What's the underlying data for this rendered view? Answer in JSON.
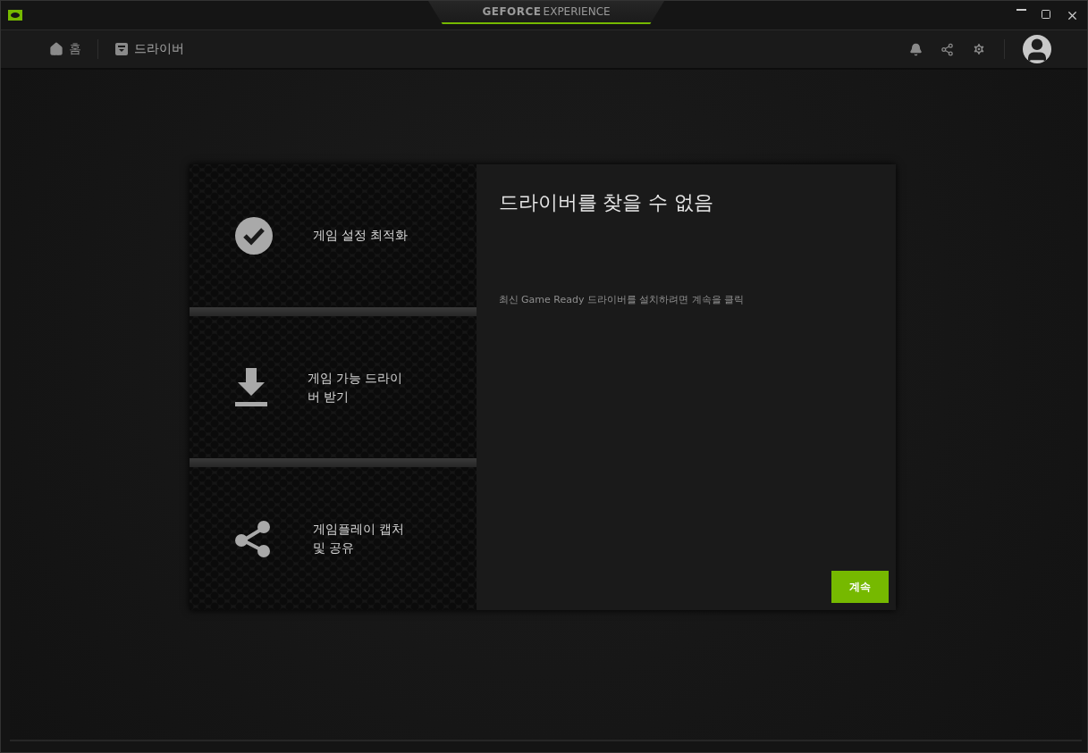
{
  "window": {
    "logo": {
      "brand": "GEFORCE",
      "product": "EXPERIENCE"
    }
  },
  "nav": {
    "tabs": [
      {
        "label": "홈",
        "kind": "home",
        "selected": false
      },
      {
        "label": "드라이버",
        "kind": "driver",
        "selected": true
      }
    ]
  },
  "features": [
    {
      "kind": "check",
      "label": "게임 설정 최적화"
    },
    {
      "kind": "download",
      "label": "게임 가능 드라이\n버 받기"
    },
    {
      "kind": "share",
      "label": "게임플레이 캡처\n및 공유"
    }
  ],
  "panel": {
    "title": "드라이버를 찾을 수 없음",
    "description": "최신 Game Ready 드라이버를 설치하려면 계속을 클릭",
    "button": "계속"
  }
}
